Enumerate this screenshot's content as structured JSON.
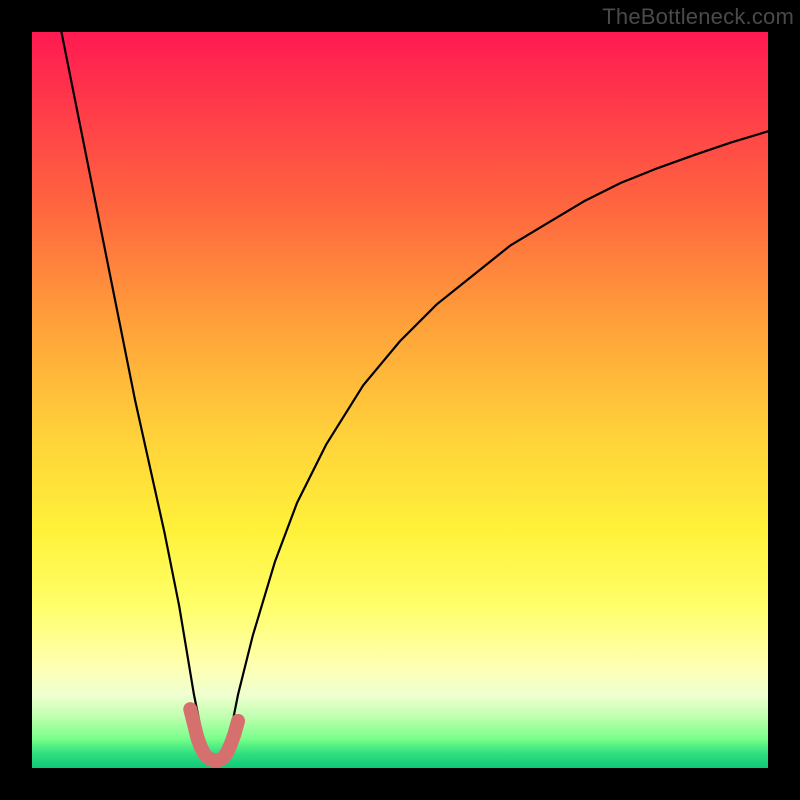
{
  "watermark": "TheBottleneck.com",
  "colors": {
    "background": "#000000",
    "curve": "#000000",
    "highlight": "#d6706f"
  },
  "chart_data": {
    "type": "line",
    "title": "",
    "xlabel": "",
    "ylabel": "",
    "xlim": [
      0,
      100
    ],
    "ylim": [
      0,
      100
    ],
    "annotations": [
      "TheBottleneck.com"
    ],
    "series": [
      {
        "name": "bottleneck-curve",
        "x": [
          4,
          6,
          8,
          10,
          12,
          14,
          16,
          18,
          20,
          21,
          22,
          23,
          24,
          25,
          26,
          27,
          28,
          30,
          33,
          36,
          40,
          45,
          50,
          55,
          60,
          65,
          70,
          75,
          80,
          85,
          90,
          95,
          100
        ],
        "y": [
          100,
          90,
          80,
          70,
          60,
          50,
          41,
          32,
          22,
          16,
          10,
          5,
          2,
          1,
          2,
          5,
          10,
          18,
          28,
          36,
          44,
          52,
          58,
          63,
          67,
          71,
          74,
          77,
          79.5,
          81.5,
          83.3,
          85,
          86.5
        ]
      },
      {
        "name": "optimal-highlight",
        "x": [
          21.5,
          22,
          22.5,
          23,
          23.5,
          24,
          24.5,
          25,
          25.5,
          26,
          26.5,
          27,
          27.5,
          28
        ],
        "y": [
          8,
          6,
          4,
          2.7,
          1.8,
          1.3,
          1.1,
          1,
          1.1,
          1.4,
          2.1,
          3.2,
          4.6,
          6.4
        ]
      }
    ]
  }
}
